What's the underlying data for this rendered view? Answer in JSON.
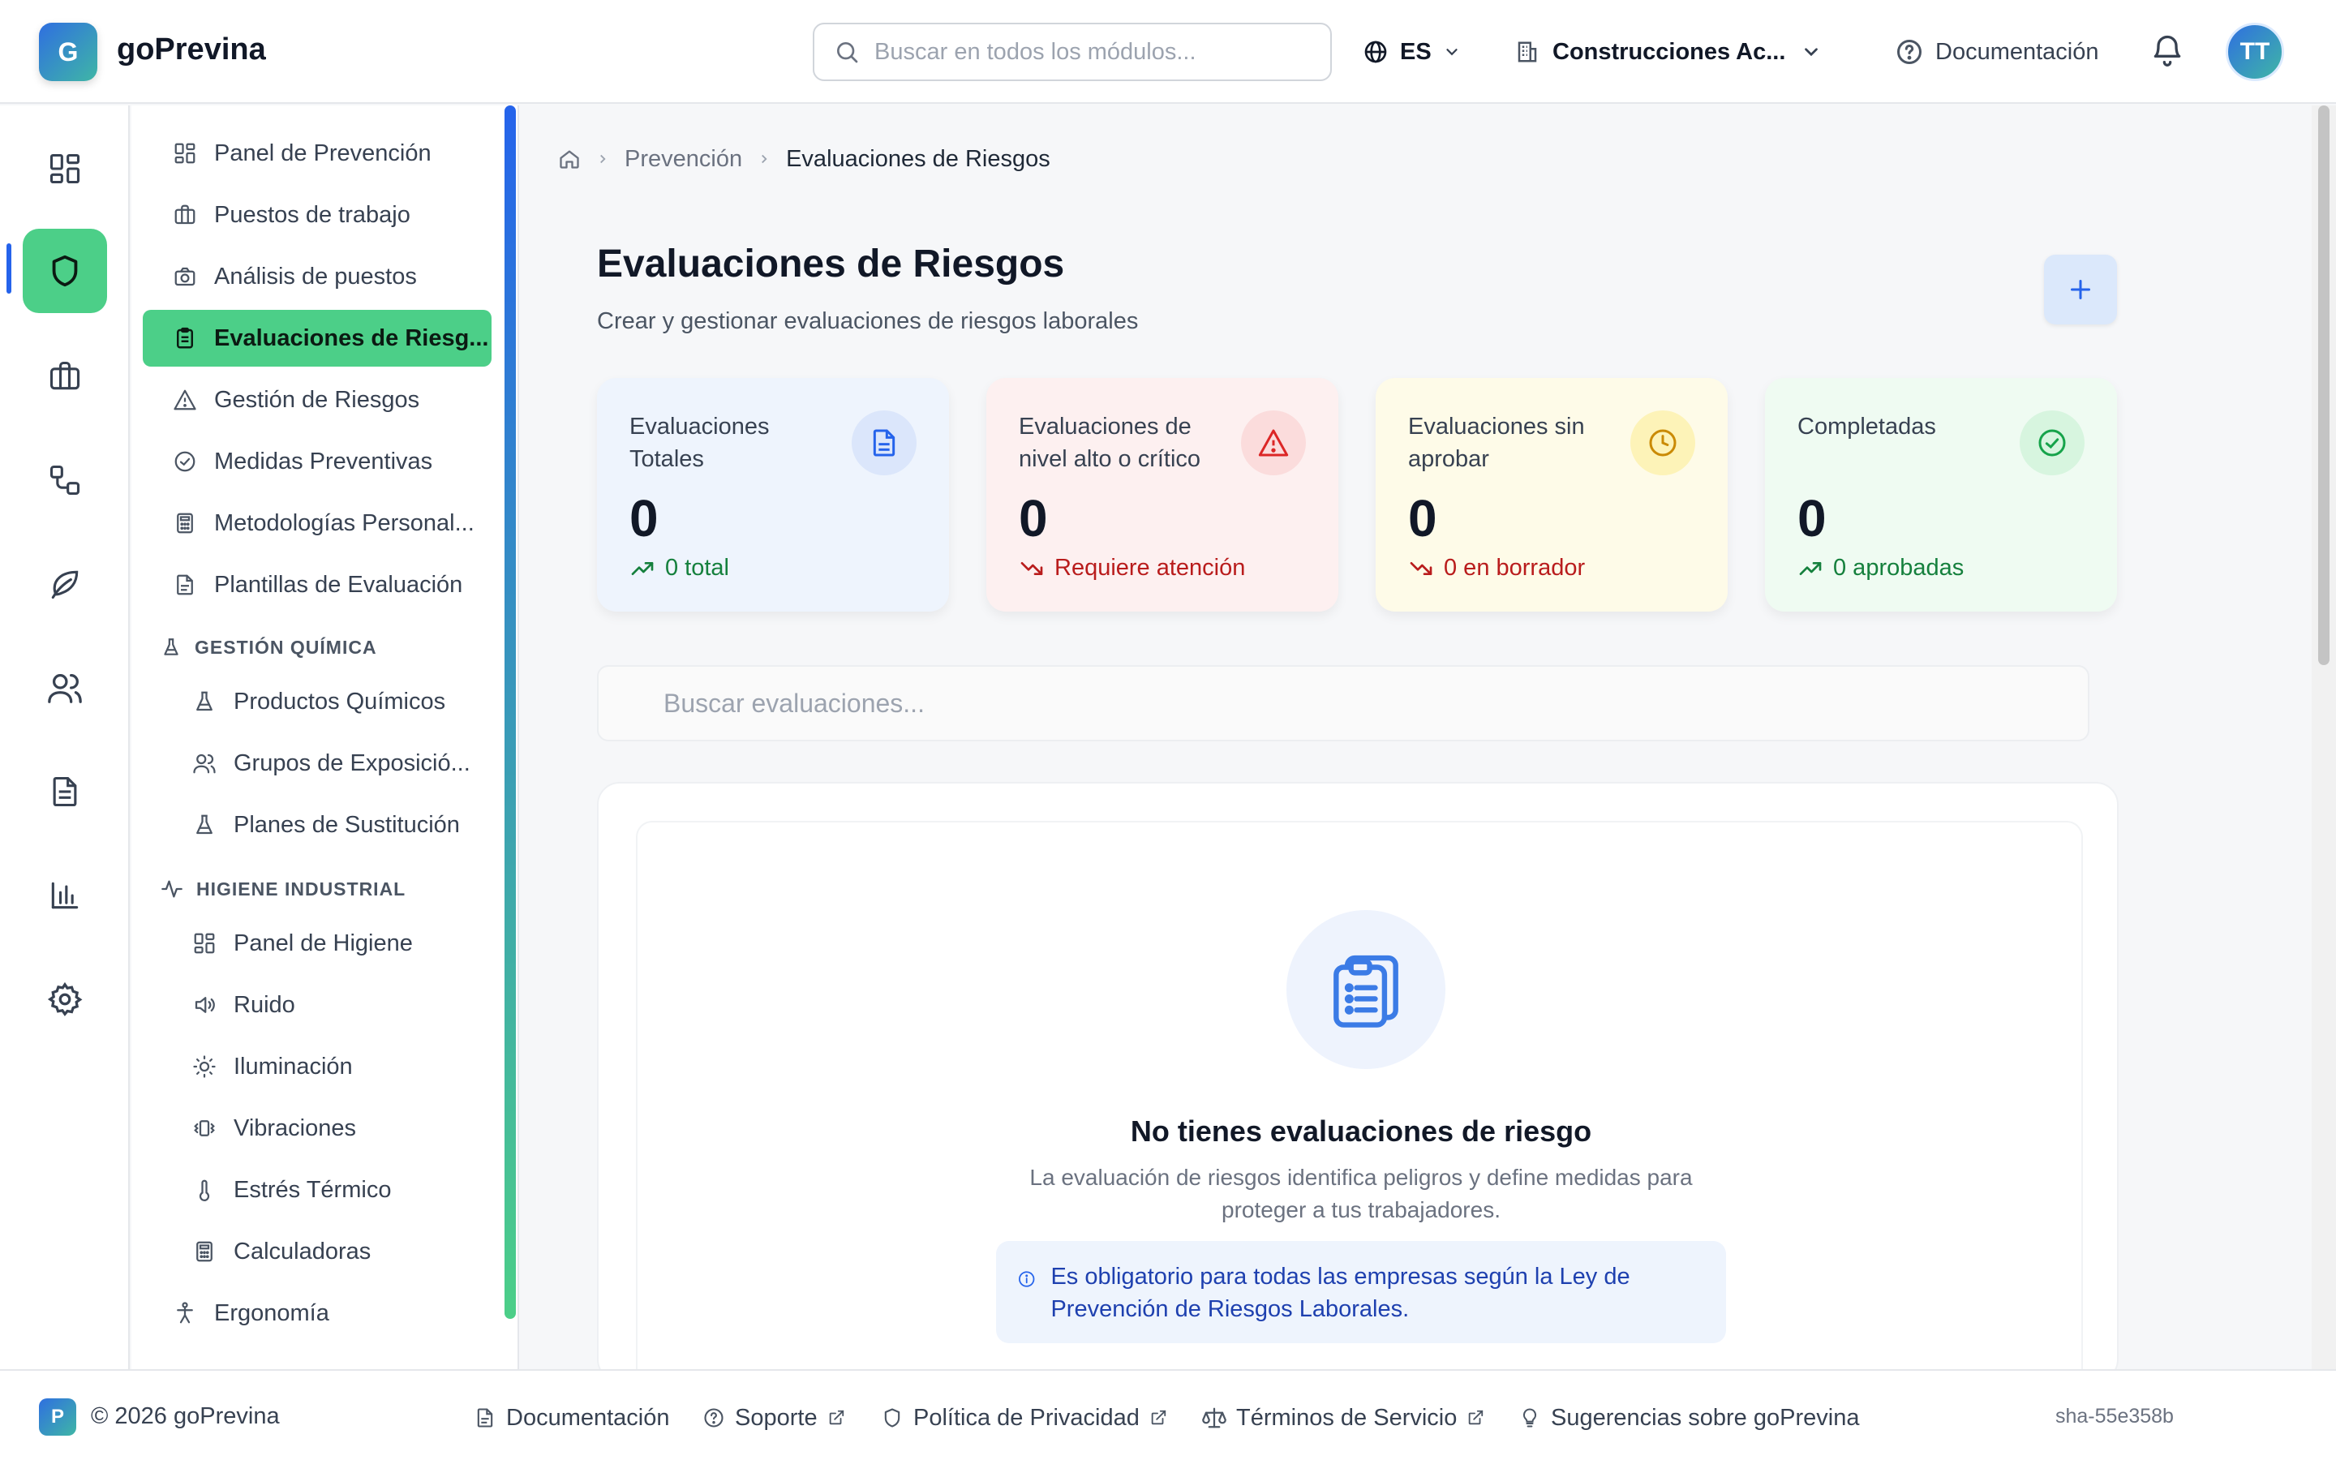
{
  "header": {
    "logo_letter": "G",
    "brand": "goPrevina",
    "search_placeholder": "Buscar en todos los módulos...",
    "language": "ES",
    "company": "Construcciones Ac...",
    "docs_label": "Documentación",
    "avatar_initials": "TT"
  },
  "rail": {
    "items": [
      "dashboard-icon",
      "shield-icon",
      "briefcase-icon",
      "workflow-icon",
      "leaf-icon",
      "users-icon",
      "document-icon",
      "bar-chart-icon",
      "gear-icon"
    ],
    "active_index": 1
  },
  "sidebar": {
    "items": [
      {
        "label": "Panel de Prevención",
        "icon": "dashboard-icon"
      },
      {
        "label": "Puestos de trabajo",
        "icon": "briefcase-icon"
      },
      {
        "label": "Análisis de puestos",
        "icon": "camera-icon"
      },
      {
        "label": "Evaluaciones de Riesg...",
        "icon": "clipboard-icon",
        "active": true
      },
      {
        "label": "Gestión de Riesgos",
        "icon": "warning-icon"
      },
      {
        "label": "Medidas Preventivas",
        "icon": "check-circle-icon"
      },
      {
        "label": "Metodologías Personal...",
        "icon": "calculator-icon"
      },
      {
        "label": "Plantillas de Evaluación",
        "icon": "file-icon"
      }
    ],
    "section_chem": {
      "title": "GESTIÓN QUÍMICA",
      "items": [
        {
          "label": "Productos Químicos",
          "icon": "flask-icon"
        },
        {
          "label": "Grupos de Exposició...",
          "icon": "users-icon"
        },
        {
          "label": "Planes de Sustitución",
          "icon": "flask-icon"
        }
      ]
    },
    "section_hyg": {
      "title": "HIGIENE INDUSTRIAL",
      "items": [
        {
          "label": "Panel de Higiene",
          "icon": "dashboard-icon"
        },
        {
          "label": "Ruido",
          "icon": "speaker-icon"
        },
        {
          "label": "Iluminación",
          "icon": "sun-icon"
        },
        {
          "label": "Vibraciones",
          "icon": "vibration-icon"
        },
        {
          "label": "Estrés Térmico",
          "icon": "thermometer-icon"
        },
        {
          "label": "Calculadoras",
          "icon": "calculator-icon"
        }
      ]
    },
    "ergonomia": "Ergonomía"
  },
  "breadcrumb": {
    "section": "Prevención",
    "current": "Evaluaciones de Riesgos"
  },
  "page": {
    "title": "Evaluaciones de Riesgos",
    "subtitle": "Crear y gestionar evaluaciones de riesgos laborales"
  },
  "cards": [
    {
      "title": "Evaluaciones Totales",
      "value": "0",
      "foot": "0 total",
      "icon": "document-icon",
      "bg": "#eef4fd",
      "icon_bg": "#dbe6fb",
      "icon_color": "#2563eb",
      "foot_color": "#15803d",
      "trend": "up"
    },
    {
      "title": "Evaluaciones de nivel alto o crítico",
      "value": "0",
      "foot": "Requiere atención",
      "icon": "warning-icon",
      "bg": "#fdf0f0",
      "icon_bg": "#fbdcdc",
      "icon_color": "#dc2626",
      "foot_color": "#b91c1c",
      "trend": "down"
    },
    {
      "title": "Evaluaciones sin aprobar",
      "value": "0",
      "foot": "0 en borrador",
      "icon": "clock-icon",
      "bg": "#fefbe8",
      "icon_bg": "#fdf3b8",
      "icon_color": "#ca8a04",
      "foot_color": "#b91c1c",
      "trend": "down"
    },
    {
      "title": "Completadas",
      "value": "0",
      "foot": "0 aprobadas",
      "icon": "check-circle-icon",
      "bg": "#effbf2",
      "icon_bg": "#d7f5df",
      "icon_color": "#16a34a",
      "foot_color": "#15803d",
      "trend": "up"
    }
  ],
  "search_evals_placeholder": "Buscar evaluaciones...",
  "empty": {
    "title": "No tienes evaluaciones de riesgo",
    "description": "La evaluación de riesgos identifica peligros y define medidas para proteger a tus trabajadores.",
    "info": "Es obligatorio para todas las empresas según la Ley de Prevención de Riesgos Laborales."
  },
  "footer": {
    "badge": "P",
    "copyright": "© 2026 goPrevina",
    "docs": "Documentación",
    "support": "Soporte",
    "privacy": "Política de Privacidad",
    "terms": "Términos de Servicio",
    "suggestions": "Sugerencias sobre goPrevina",
    "sha": "sha-55e358b"
  },
  "colors": {
    "accent_green": "#4ccf88",
    "accent_blue": "#2563eb"
  }
}
